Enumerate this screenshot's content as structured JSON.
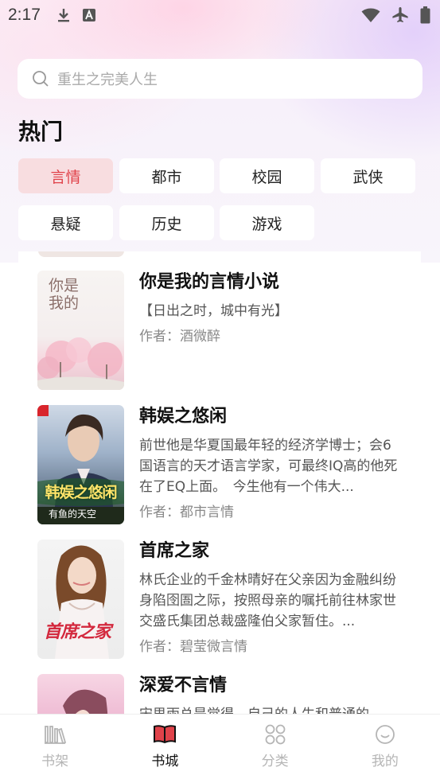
{
  "status_bar": {
    "time": "2:17",
    "icons": [
      "download-icon",
      "font-app-icon",
      "wifi-icon",
      "airplane-icon",
      "battery-icon"
    ]
  },
  "search": {
    "placeholder": "重生之完美人生"
  },
  "section": {
    "title": "热门"
  },
  "categories": [
    {
      "label": "言情",
      "active": true
    },
    {
      "label": "都市",
      "active": false
    },
    {
      "label": "校园",
      "active": false
    },
    {
      "label": "武侠",
      "active": false
    },
    {
      "label": "悬疑",
      "active": false
    },
    {
      "label": "历史",
      "active": false
    },
    {
      "label": "游戏",
      "active": false
    }
  ],
  "books": [
    {
      "title": "你是我的言情小说",
      "desc": "【日出之时，城中有光】",
      "author": "作者：酒微醉",
      "cover_text": "你是我的"
    },
    {
      "title": "韩娱之悠闲",
      "desc": "前世他是华夏国最年轻的经济学博士；会6国语言的天才语言学家，可最终IQ高的他死在了EQ上面。　今生他有一个伟大...",
      "author": "作者：都市言情",
      "cover_text": "韩娱之悠闲",
      "cover_subtext": "有鱼的天空"
    },
    {
      "title": "首席之家",
      "desc": "林氏企业的千金林晴好在父亲因为金融纠纷身陷囹圄之际，按照母亲的嘱托前往林家世交盛氏集团总裁盛隆伯父家暂住。...",
      "author": "作者：碧莹微言情",
      "cover_text": "首席之家"
    },
    {
      "title": "深爱不言情",
      "desc": "宋思雨总是觉得，自己的人生和普通的",
      "author": "",
      "cover_text": ""
    }
  ],
  "bottom_nav": [
    {
      "label": "书架",
      "icon": "bookshelf-icon",
      "active": false
    },
    {
      "label": "书城",
      "icon": "open-book-icon",
      "active": true
    },
    {
      "label": "分类",
      "icon": "category-grid-icon",
      "active": false
    },
    {
      "label": "我的",
      "icon": "smiley-profile-icon",
      "active": false
    }
  ],
  "colors": {
    "accent": "#e0424a",
    "chip_active_bg": "#f8dde0",
    "inactive_nav": "#b5b5b5"
  }
}
